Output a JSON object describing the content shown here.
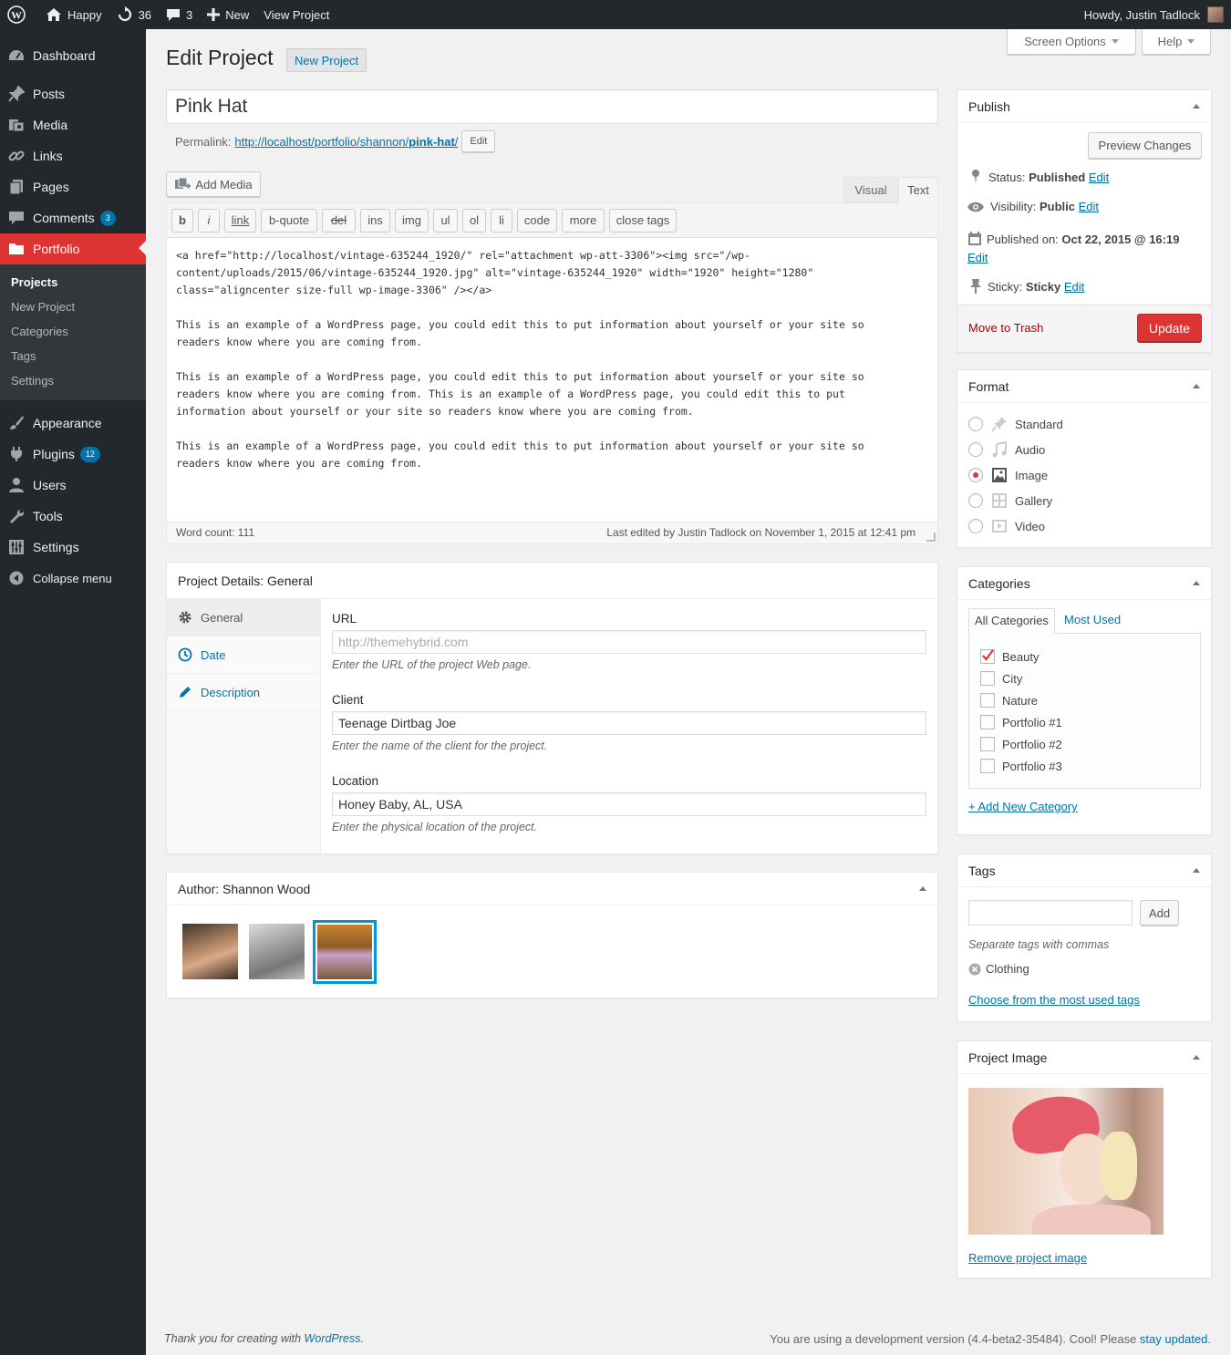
{
  "adminbar": {
    "site_name": "Happy",
    "updates_count": "36",
    "comments_count": "3",
    "new_label": "New",
    "view_label": "View Project",
    "greeting": "Howdy, Justin Tadlock"
  },
  "sidebar": {
    "items": [
      {
        "label": "Dashboard"
      },
      {
        "label": "Posts"
      },
      {
        "label": "Media"
      },
      {
        "label": "Links"
      },
      {
        "label": "Pages"
      },
      {
        "label": "Comments",
        "badge": "3"
      },
      {
        "label": "Portfolio"
      },
      {
        "label": "Appearance"
      },
      {
        "label": "Plugins",
        "badge": "12"
      },
      {
        "label": "Users"
      },
      {
        "label": "Tools"
      },
      {
        "label": "Settings"
      }
    ],
    "submenu": [
      "Projects",
      "New Project",
      "Categories",
      "Tags",
      "Settings"
    ],
    "collapse": "Collapse menu"
  },
  "screen_options": "Screen Options",
  "help": "Help",
  "page_title": "Edit Project",
  "add_new": "New Project",
  "post_title": "Pink Hat",
  "permalink": {
    "label": "Permalink:",
    "url_base": "http://localhost/portfolio/shannon/",
    "slug": "pink-hat",
    "url_end": "/",
    "edit": "Edit"
  },
  "editor": {
    "add_media": "Add Media",
    "tab_visual": "Visual",
    "tab_text": "Text",
    "quicktags": [
      "b",
      "i",
      "link",
      "b-quote",
      "del",
      "ins",
      "img",
      "ul",
      "ol",
      "li",
      "code",
      "more",
      "close tags"
    ],
    "content": "<a href=\"http://localhost/vintage-635244_1920/\" rel=\"attachment wp-att-3306\"><img src=\"/wp-\ncontent/uploads/2015/06/vintage-635244_1920.jpg\" alt=\"vintage-635244_1920\" width=\"1920\" height=\"1280\"\nclass=\"aligncenter size-full wp-image-3306\" /></a>\n\nThis is an example of a WordPress page, you could edit this to put information about yourself or your site so\nreaders know where you are coming from.\n\nThis is an example of a WordPress page, you could edit this to put information about yourself or your site so\nreaders know where you are coming from. This is an example of a WordPress page, you could edit this to put\ninformation about yourself or your site so readers know where you are coming from.\n\nThis is an example of a WordPress page, you could edit this to put information about yourself or your site so\nreaders know where you are coming from.",
    "word_count": "Word count: 111",
    "last_edited": "Last edited by Justin Tadlock on November 1, 2015 at 12:41 pm"
  },
  "project_details": {
    "title": "Project Details: General",
    "tabs": [
      "General",
      "Date",
      "Description"
    ],
    "fields": [
      {
        "label": "URL",
        "value": "",
        "placeholder": "http://themehybrid.com",
        "desc": "Enter the URL of the project Web page."
      },
      {
        "label": "Client",
        "value": "Teenage Dirtbag Joe",
        "placeholder": "",
        "desc": "Enter the name of the client for the project."
      },
      {
        "label": "Location",
        "value": "Honey Baby, AL, USA",
        "placeholder": "",
        "desc": "Enter the physical location of the project."
      }
    ]
  },
  "author_box": {
    "title": "Author: Shannon Wood"
  },
  "publish": {
    "title": "Publish",
    "preview": "Preview Changes",
    "status_label": "Status:",
    "status_value": "Published",
    "visibility_label": "Visibility:",
    "visibility_value": "Public",
    "published_label": "Published on:",
    "published_value": "Oct 22, 2015 @ 16:19",
    "sticky_label": "Sticky:",
    "sticky_value": "Sticky",
    "edit": "Edit",
    "trash": "Move to Trash",
    "update": "Update"
  },
  "format": {
    "title": "Format",
    "options": [
      "Standard",
      "Audio",
      "Image",
      "Gallery",
      "Video"
    ],
    "selected": "Image"
  },
  "categories": {
    "title": "Categories",
    "tab_all": "All Categories",
    "tab_used": "Most Used",
    "items": [
      {
        "label": "Beauty",
        "checked": true
      },
      {
        "label": "City",
        "checked": false
      },
      {
        "label": "Nature",
        "checked": false
      },
      {
        "label": "Portfolio #1",
        "checked": false
      },
      {
        "label": "Portfolio #2",
        "checked": false
      },
      {
        "label": "Portfolio #3",
        "checked": false
      }
    ],
    "add_new": "+ Add New Category"
  },
  "tags": {
    "title": "Tags",
    "add": "Add",
    "hint": "Separate tags with commas",
    "current": "Clothing",
    "choose": "Choose from the most used tags"
  },
  "project_image": {
    "title": "Project Image",
    "remove": "Remove project image"
  },
  "footer": {
    "thanks_prefix": "Thank you for creating with ",
    "wordpress": "WordPress",
    "thanks_suffix": ".",
    "version_prefix": "You are using a development version (4.4-beta2-35484). Cool! Please ",
    "stay_updated": "stay updated",
    "version_suffix": "."
  },
  "colors": {
    "accent": "#dd3333",
    "link": "#0073aa",
    "adminbar": "#23282d"
  }
}
